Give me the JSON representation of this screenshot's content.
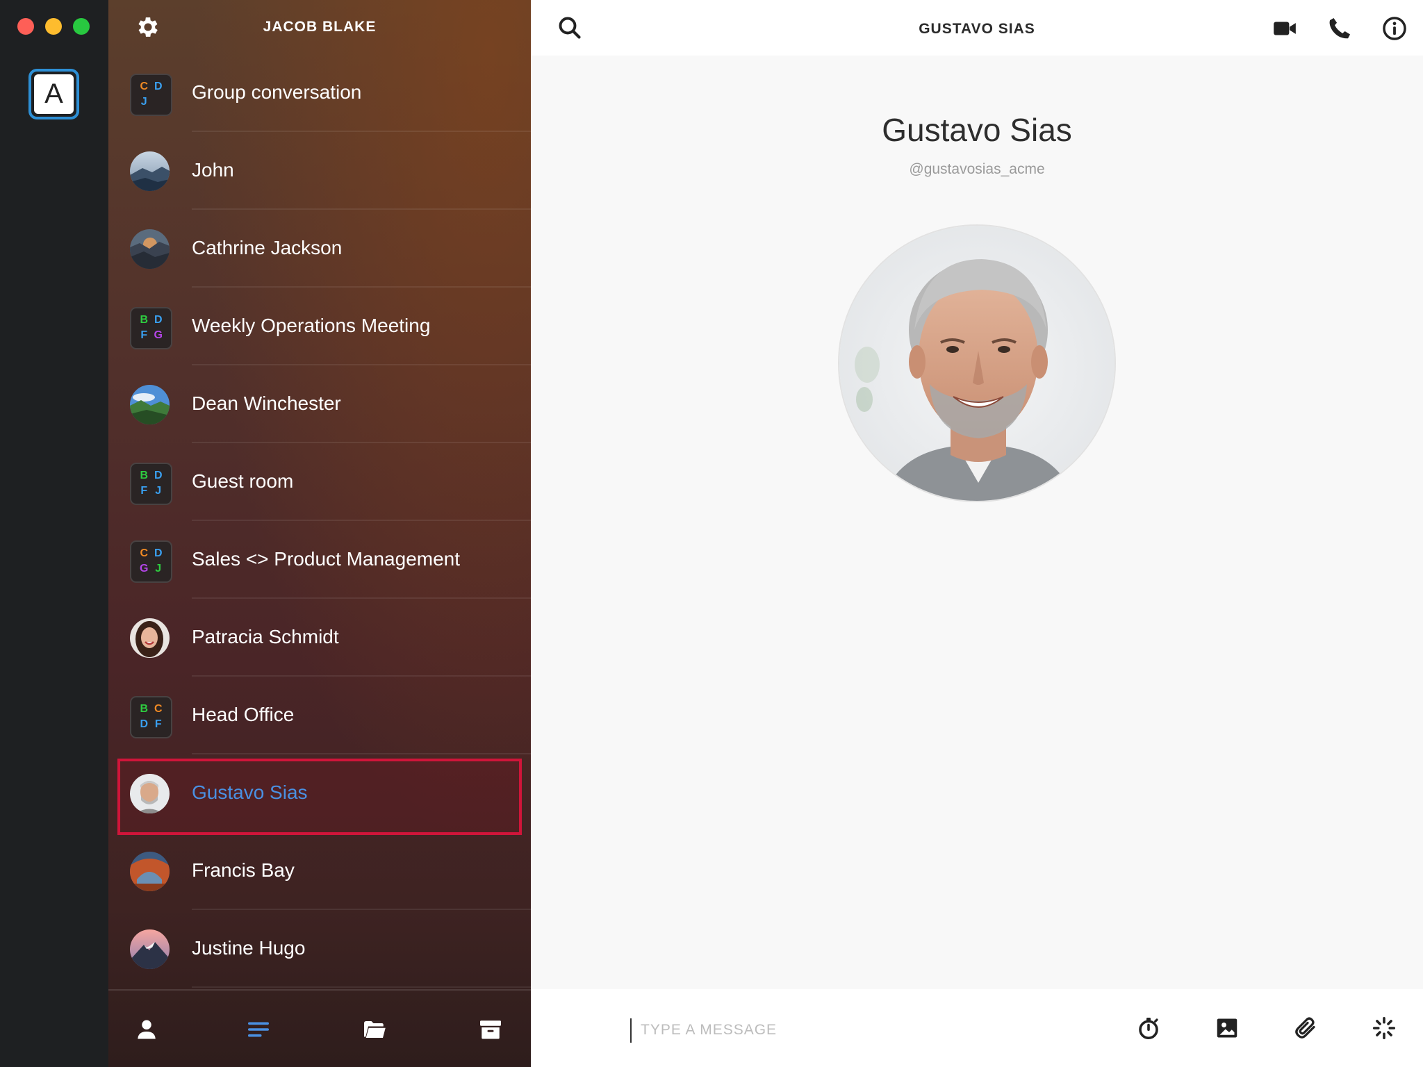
{
  "window": {
    "controls": [
      "close",
      "minimize",
      "maximize"
    ]
  },
  "accounts": {
    "active_letter": "A"
  },
  "sidebar": {
    "title": "JACOB BLAKE",
    "conversations": [
      {
        "name": "Group conversation",
        "type": "group",
        "letters": [
          {
            "l": "C",
            "c": "#f08a24"
          },
          {
            "l": "D",
            "c": "#3aa0f0"
          },
          {
            "l": "J",
            "c": "#3aa0f0"
          },
          {
            "l": "",
            "c": ""
          }
        ]
      },
      {
        "name": "John",
        "type": "person",
        "avatar": "mountain-avatar"
      },
      {
        "name": "Cathrine Jackson",
        "type": "person",
        "avatar": "canyon-avatar"
      },
      {
        "name": "Weekly Operations Meeting",
        "type": "group",
        "letters": [
          {
            "l": "B",
            "c": "#2ecc40"
          },
          {
            "l": "D",
            "c": "#3aa0f0"
          },
          {
            "l": "F",
            "c": "#3aa0f0"
          },
          {
            "l": "G",
            "c": "#b445e8"
          }
        ]
      },
      {
        "name": "Dean Winchester",
        "type": "person",
        "avatar": "valley-avatar"
      },
      {
        "name": "Guest room",
        "type": "group",
        "letters": [
          {
            "l": "B",
            "c": "#2ecc40"
          },
          {
            "l": "D",
            "c": "#3aa0f0"
          },
          {
            "l": "F",
            "c": "#3aa0f0"
          },
          {
            "l": "J",
            "c": "#3aa0f0"
          }
        ]
      },
      {
        "name": "Sales <> Product Management",
        "type": "group",
        "letters": [
          {
            "l": "C",
            "c": "#f08a24"
          },
          {
            "l": "D",
            "c": "#3aa0f0"
          },
          {
            "l": "G",
            "c": "#b445e8"
          },
          {
            "l": "J",
            "c": "#2ecc40"
          }
        ]
      },
      {
        "name": "Patracia Schmidt",
        "type": "person",
        "avatar": "woman-avatar"
      },
      {
        "name": "Head Office",
        "type": "group",
        "letters": [
          {
            "l": "B",
            "c": "#2ecc40"
          },
          {
            "l": "C",
            "c": "#f08a24"
          },
          {
            "l": "D",
            "c": "#3aa0f0"
          },
          {
            "l": "F",
            "c": "#3aa0f0"
          }
        ]
      },
      {
        "name": "Gustavo Sias",
        "type": "person",
        "avatar": "man-avatar",
        "selected": true
      },
      {
        "name": "Francis Bay",
        "type": "person",
        "avatar": "arch-avatar"
      },
      {
        "name": "Justine Hugo",
        "type": "person",
        "avatar": "sunset-peak-avatar"
      }
    ],
    "bottom_tabs": [
      "contacts-tab",
      "conversations-tab",
      "files-tab",
      "archive-tab"
    ],
    "active_tab": "conversations-tab"
  },
  "main": {
    "header_title": "GUSTAVO SIAS",
    "profile_name": "Gustavo Sias",
    "profile_handle": "@gustavosias_acme",
    "header_actions": [
      "video-call-icon",
      "phone-call-icon",
      "info-icon"
    ],
    "composer": {
      "placeholder": "TYPE A MESSAGE",
      "value": "",
      "actions": [
        "timer-icon",
        "image-icon",
        "paperclip-icon",
        "ping-icon"
      ]
    }
  },
  "colors": {
    "accent": "#4a90e2",
    "selection_border": "#d0153a",
    "account_ring": "#2d8fd5"
  }
}
